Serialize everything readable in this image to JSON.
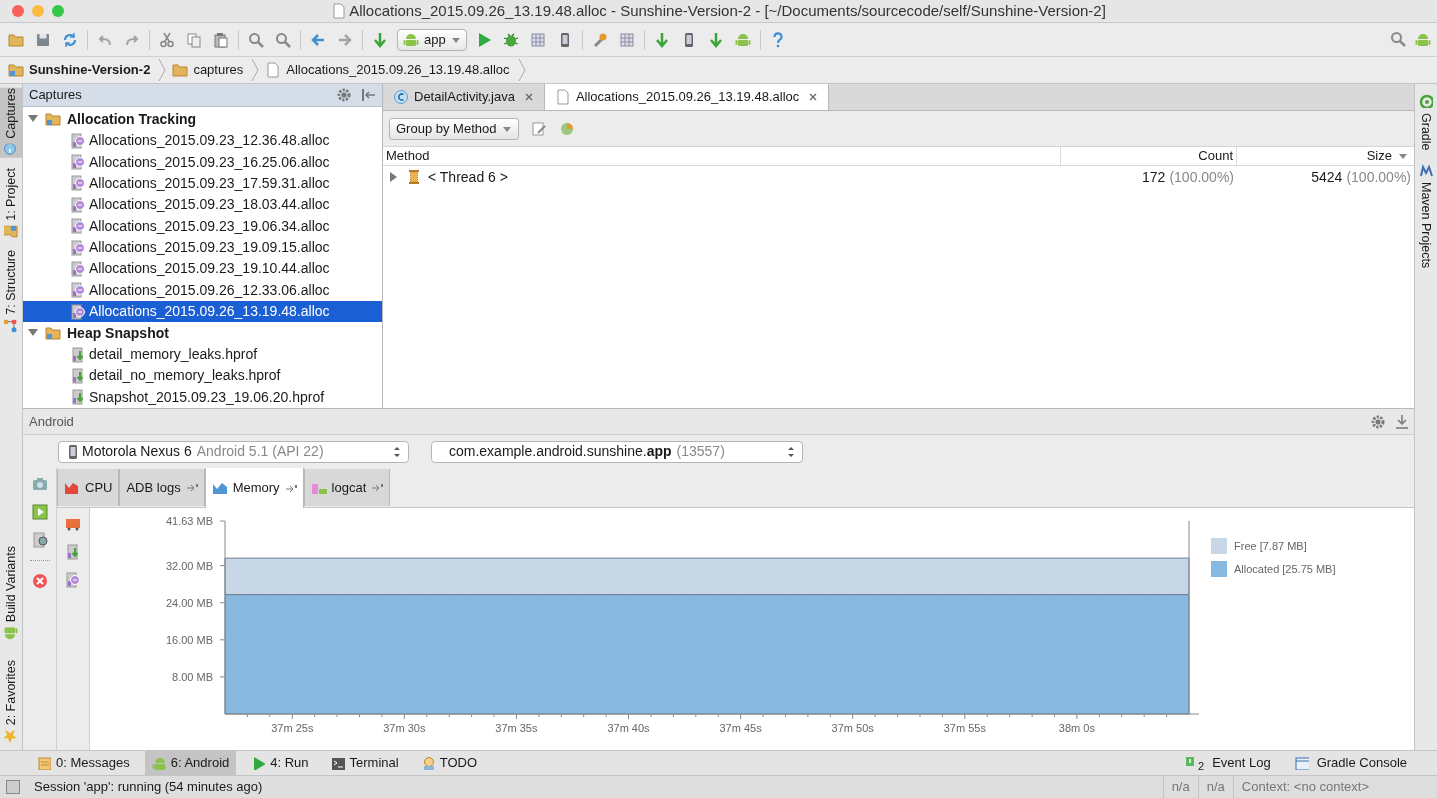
{
  "window": {
    "title": "Allocations_2015.09.26_13.19.48.alloc - Sunshine-Version-2 - [~/Documents/sourcecode/self/Sunshine-Version-2]"
  },
  "toolbar": {
    "run_config": "app"
  },
  "breadcrumbs": [
    {
      "label": "Sunshine-Version-2",
      "kind": "project"
    },
    {
      "label": "captures",
      "kind": "folder"
    },
    {
      "label": "Allocations_2015.09.26_13.19.48.alloc",
      "kind": "file"
    }
  ],
  "left_tool_tabs": [
    {
      "label": "Captures",
      "kind": "captures",
      "selected": true
    },
    {
      "label": "1: Project",
      "kind": "project",
      "selected": false
    },
    {
      "label": "7: Structure",
      "kind": "structure",
      "selected": false
    }
  ],
  "left_tool_tabs_lower": [
    {
      "label": "Build Variants",
      "kind": "android",
      "selected": false
    },
    {
      "label": "2: Favorites",
      "kind": "star",
      "selected": false
    }
  ],
  "captures": {
    "title": "Captures",
    "groups": [
      {
        "label": "Allocation Tracking",
        "expanded": true,
        "children": [
          {
            "label": "Allocations_2015.09.23_12.36.48.alloc",
            "kind": "alloc",
            "selected": false
          },
          {
            "label": "Allocations_2015.09.23_16.25.06.alloc",
            "kind": "alloc",
            "selected": false
          },
          {
            "label": "Allocations_2015.09.23_17.59.31.alloc",
            "kind": "alloc",
            "selected": false
          },
          {
            "label": "Allocations_2015.09.23_18.03.44.alloc",
            "kind": "alloc",
            "selected": false
          },
          {
            "label": "Allocations_2015.09.23_19.06.34.alloc",
            "kind": "alloc",
            "selected": false
          },
          {
            "label": "Allocations_2015.09.23_19.09.15.alloc",
            "kind": "alloc",
            "selected": false
          },
          {
            "label": "Allocations_2015.09.23_19.10.44.alloc",
            "kind": "alloc",
            "selected": false
          },
          {
            "label": "Allocations_2015.09.26_12.33.06.alloc",
            "kind": "alloc",
            "selected": false
          },
          {
            "label": "Allocations_2015.09.26_13.19.48.alloc",
            "kind": "alloc",
            "selected": true
          }
        ]
      },
      {
        "label": "Heap Snapshot",
        "expanded": true,
        "children": [
          {
            "label": "detail_memory_leaks.hprof",
            "kind": "hprof",
            "selected": false
          },
          {
            "label": "detail_no_memory_leaks.hprof",
            "kind": "hprof",
            "selected": false
          },
          {
            "label": "Snapshot_2015.09.23_19.06.20.hprof",
            "kind": "hprof",
            "selected": false
          }
        ]
      }
    ]
  },
  "editor_tabs": [
    {
      "label": "DetailActivity.java",
      "kind": "java",
      "selected": false
    },
    {
      "label": "Allocations_2015.09.26_13.19.48.alloc",
      "kind": "file",
      "selected": true
    }
  ],
  "allocation_view": {
    "group_by": "Group by Method",
    "table": {
      "columns": [
        "Method",
        "Count",
        "Size"
      ],
      "rows": [
        {
          "method": "< Thread 6 >",
          "expanded": false,
          "count": "172",
          "count_share": "(100.00%)",
          "size": "5424",
          "size_share": "(100.00%)"
        }
      ]
    }
  },
  "right_tool_tabs": [
    {
      "label": "Gradle",
      "kind": "gradle"
    },
    {
      "label": "Maven Projects",
      "kind": "maven"
    }
  ],
  "android": {
    "title": "Android",
    "device": {
      "name": "Motorola Nexus 6",
      "detail": "Android 5.1 (API 22)"
    },
    "process": {
      "name": "com.example.android.sunshine.**app**",
      "pid": "(13557)"
    },
    "tabs": [
      {
        "label": "CPU",
        "kind": "cpu",
        "selected": false
      },
      {
        "label": "ADB logs",
        "kind": "none",
        "selected": false
      },
      {
        "label": "Memory",
        "kind": "memory",
        "selected": true
      },
      {
        "label": "logcat",
        "kind": "logcat",
        "selected": false
      }
    ],
    "chart_data": {
      "type": "area",
      "stacked": true,
      "categories": [
        null,
        null,
        null,
        "37m 25s",
        null,
        null,
        null,
        null,
        "37m 30s",
        null,
        null,
        null,
        null,
        "37m 35s",
        null,
        null,
        null,
        null,
        "37m 40s",
        null,
        null,
        null,
        null,
        "37m 45s",
        null,
        null,
        null,
        null,
        "37m 50s",
        null,
        null,
        null,
        null,
        "37m 55s",
        null,
        null,
        null,
        null,
        "38m 0s",
        null,
        null,
        null,
        null,
        null
      ],
      "series": [
        {
          "name": "Allocated [25.75 MB]",
          "color": "#87b8e0",
          "values": [
            25.75,
            25.75,
            25.75,
            25.75,
            25.75,
            25.75,
            25.75,
            25.75,
            25.75,
            25.75,
            25.75,
            25.75,
            25.75,
            25.75,
            25.75,
            25.75,
            25.75,
            25.75,
            25.75,
            25.75,
            25.75,
            25.75,
            25.75,
            25.75,
            25.75,
            25.75,
            25.75,
            25.75,
            25.75,
            25.75,
            25.75,
            25.75,
            25.75,
            25.75,
            25.75,
            25.75,
            25.75,
            25.75,
            25.75,
            25.75,
            25.75,
            25.75,
            25.75,
            25.75
          ]
        },
        {
          "name": "Free [7.87 MB]",
          "color": "#c7d7e5",
          "values": [
            7.87,
            7.87,
            7.87,
            7.87,
            7.87,
            7.87,
            7.87,
            7.87,
            7.87,
            7.87,
            7.87,
            7.87,
            7.87,
            7.87,
            7.87,
            7.87,
            7.87,
            7.87,
            7.87,
            7.87,
            7.87,
            7.87,
            7.87,
            7.87,
            7.87,
            7.87,
            7.87,
            7.87,
            7.87,
            7.87,
            7.87,
            7.87,
            7.87,
            7.87,
            7.87,
            7.87,
            7.87,
            7.87,
            7.87,
            7.87,
            7.87,
            7.87,
            7.87,
            7.87
          ]
        }
      ],
      "ylim": [
        0,
        41.63
      ],
      "yticks": [
        {
          "value": 8,
          "label": "8.00 MB"
        },
        {
          "value": 16,
          "label": "16.00 MB"
        },
        {
          "value": 24,
          "label": "24.00 MB"
        },
        {
          "value": 32,
          "label": "32.00 MB"
        },
        {
          "value": 41.63,
          "label": "41.63 MB"
        }
      ]
    }
  },
  "bottom_tool_tabs": [
    {
      "label": "0: Messages",
      "kind": "messages",
      "selected": false
    },
    {
      "label": "6: Android",
      "kind": "android",
      "selected": true
    },
    {
      "label": "4: Run",
      "kind": "run",
      "selected": false
    },
    {
      "label": "Terminal",
      "kind": "terminal",
      "selected": false
    },
    {
      "label": "TODO",
      "kind": "todo",
      "selected": false
    }
  ],
  "bottom_tool_tabs_right": [
    {
      "label": "Event Log",
      "badge": "2",
      "kind": "event"
    },
    {
      "label": "Gradle Console",
      "kind": "console"
    }
  ],
  "status_bar": {
    "message": "Session 'app': running (54 minutes ago)",
    "fields": [
      "n/a",
      "n/a",
      "Context: <no context>"
    ]
  }
}
